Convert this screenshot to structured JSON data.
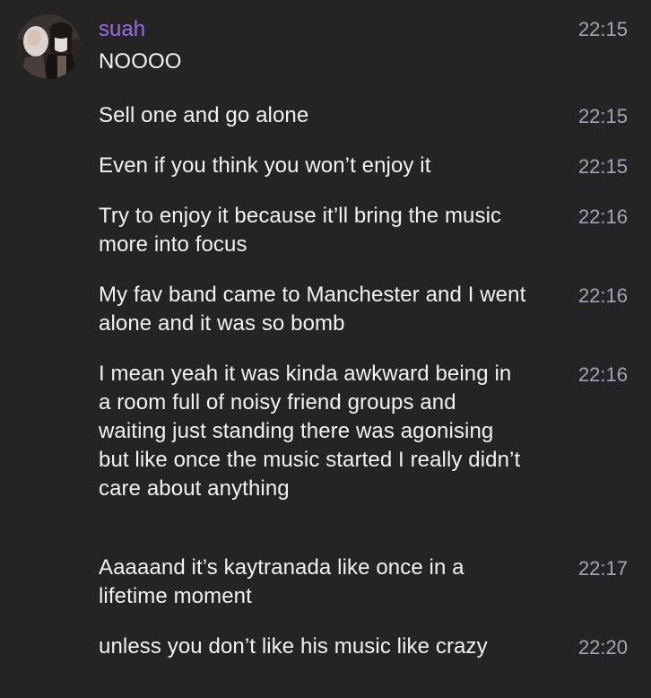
{
  "conversation": {
    "sender": {
      "name": "suah",
      "name_color": "#9a6ce0",
      "avatar": "profile-photo-avatar"
    },
    "messages": [
      {
        "text": "NOOOO",
        "time": "22:15"
      },
      {
        "text": "Sell one and go alone",
        "time": "22:15"
      },
      {
        "text": "Even if you think you won’t enjoy it",
        "time": "22:15"
      },
      {
        "text": "Try to enjoy it because it’ll bring the music more into focus",
        "time": "22:16"
      },
      {
        "text": "My fav band came to Manchester and I went alone and it was so bomb",
        "time": "22:16"
      },
      {
        "text": "I mean yeah it was kinda awkward being in a room full of noisy friend groups and waiting just standing there was agonising but like once the music started I really didn’t care about anything",
        "time": "22:16"
      },
      {
        "text": "Aaaaand it’s kaytranada like once in a lifetime moment",
        "time": "22:17"
      },
      {
        "text": "unless you don’t like his music like crazy",
        "time": "22:20"
      }
    ]
  },
  "colors": {
    "background": "#242424",
    "message_text": "#f2f2f2",
    "timestamp": "#a0a6b8"
  }
}
